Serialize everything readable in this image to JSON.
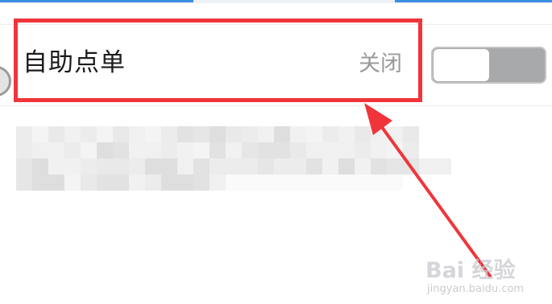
{
  "setting": {
    "title": "自助点单",
    "status": "关闭",
    "toggle_on": false
  },
  "colors": {
    "highlight": "#f0353a",
    "arrow": "#f0353a",
    "toggle_track": "#a8a9ab",
    "status_text": "#9a9a9a"
  },
  "watermark": {
    "brand": "Bai 经验",
    "url": "jingyan.baidu.com"
  }
}
